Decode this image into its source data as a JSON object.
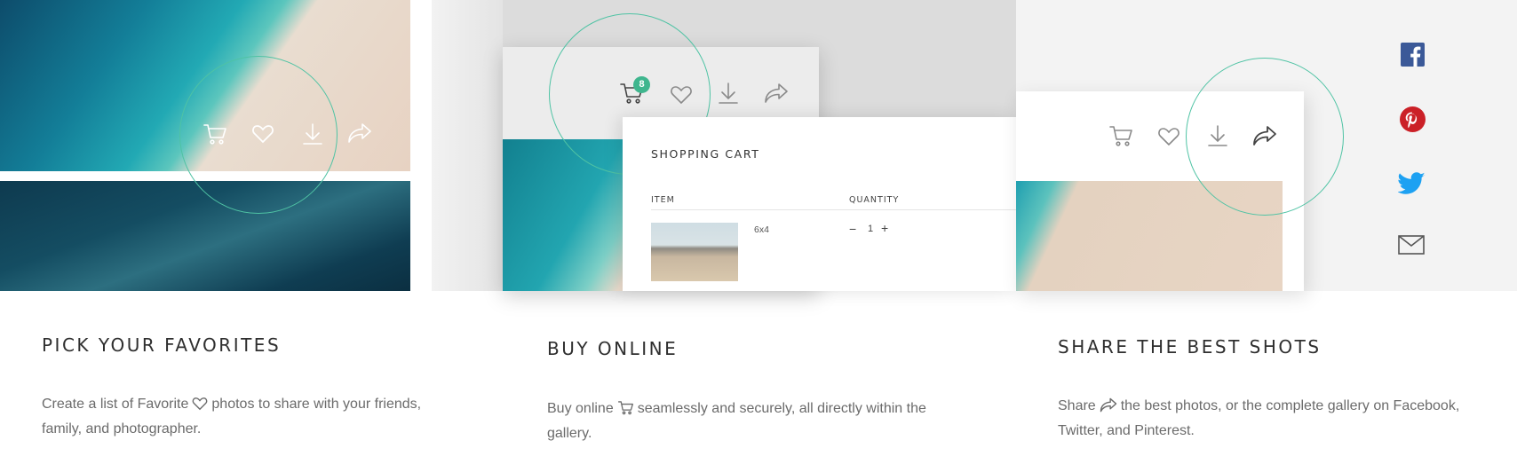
{
  "colors": {
    "accent": "#4fc3a4",
    "facebook": "#3b5998",
    "pinterest": "#cb2027",
    "twitter": "#1da1f2"
  },
  "panel2": {
    "cart_badge": "8",
    "shopping_cart": {
      "title": "SHOPPING CART",
      "col_item": "ITEM",
      "col_quantity": "QUANTITY",
      "row": {
        "size": "6x4",
        "minus": "−",
        "quantity": "1",
        "plus": "+"
      }
    }
  },
  "social_icons": [
    "facebook-icon",
    "pinterest-icon",
    "twitter-icon",
    "mail-icon"
  ],
  "features": [
    {
      "title": "PICK YOUR FAVORITES",
      "text_before": "Create a list of Favorite",
      "icon": "heart-icon",
      "text_after": "photos to share with your friends, family, and photographer."
    },
    {
      "title": "BUY ONLINE",
      "text_before": "Buy online",
      "icon": "cart-icon",
      "text_after": "seamlessly and securely, all directly within the gallery."
    },
    {
      "title": "SHARE THE BEST SHOTS",
      "text_before": "Share",
      "icon": "share-icon",
      "text_after": "the best photos, or the complete gallery on Facebook, Twitter, and Pinterest."
    }
  ]
}
